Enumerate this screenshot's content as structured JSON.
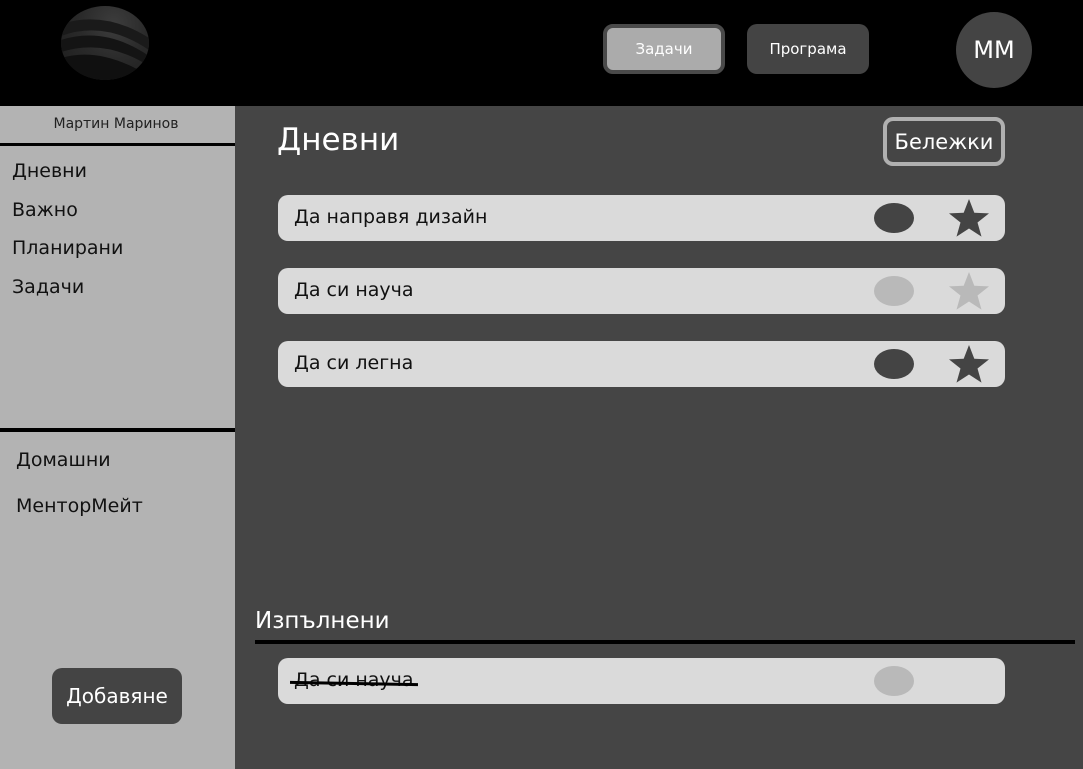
{
  "header": {
    "tabs": [
      {
        "label": "Задачи",
        "active": true
      },
      {
        "label": "Програма",
        "active": false
      }
    ],
    "avatar_initials": "ММ"
  },
  "sidebar": {
    "user_name": "Мартин Маринов",
    "nav": [
      {
        "label": "Дневни"
      },
      {
        "label": "Важно"
      },
      {
        "label": "Планирани"
      },
      {
        "label": "Задачи"
      }
    ],
    "lists": [
      {
        "label": "Домашни"
      },
      {
        "label": "МенторМейт"
      }
    ],
    "add_label": "Добавяне"
  },
  "main": {
    "title": "Дневни",
    "notes_label": "Бележки",
    "tasks": [
      {
        "label": "Да направя дизайн",
        "toggle_color": "#444444",
        "star_color": "#444444",
        "starred": true
      },
      {
        "label": "Да си науча",
        "toggle_color": "#b9b9b9",
        "star_color": "#b9b9b9",
        "starred": false
      },
      {
        "label": "Да си легна",
        "toggle_color": "#444444",
        "star_color": "#444444",
        "starred": true
      }
    ],
    "completed_title": "Изпълнени",
    "completed": [
      {
        "label": "Да си науча",
        "toggle_color": "#b9b9b9"
      }
    ]
  }
}
